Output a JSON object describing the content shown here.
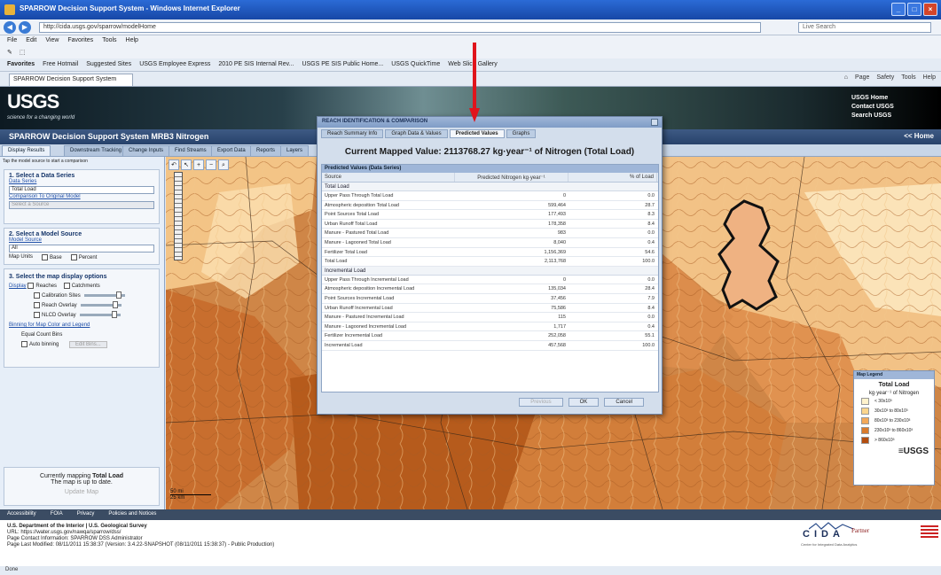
{
  "window": {
    "title": "SPARROW Decision Support System - Windows Internet Explorer"
  },
  "browser": {
    "url": "http://cida.usgs.gov/sparrow/modelHome",
    "search_placeholder": "Live Search",
    "menu": [
      "File",
      "Edit",
      "View",
      "Favorites",
      "Tools",
      "Help"
    ],
    "favorites": [
      "Favorites",
      "Free Hotmail",
      "Suggested Sites",
      "USGS Employee Express",
      "2010 PE SIS Internal Rev...",
      "USGS PE SIS Public Home...",
      "USGS QuickTime",
      "Web Slice Gallery"
    ],
    "tab": "SPARROW Decision Support System",
    "tools": [
      "Page",
      "Safety",
      "Tools",
      "Help"
    ]
  },
  "banner": {
    "logo": "USGS",
    "tagline": "science for a changing world",
    "links": [
      "USGS Home",
      "Contact USGS",
      "Search USGS"
    ]
  },
  "app": {
    "title": "SPARROW Decision Support System MRB3 Nitrogen",
    "home": "<< Home",
    "tabs": [
      "Display Results",
      "Downstream Tracking",
      "Change Inputs",
      "Find Streams",
      "Export Data",
      "Reports",
      "Layers"
    ]
  },
  "sidebar": {
    "help": "Tap the model source to start a comparison",
    "step1": {
      "title": "1. Select a Data Series",
      "label": "Data Series",
      "value": "Total Load",
      "link": "Comparison To Original Model",
      "disabled": "Select a Source"
    },
    "step2": {
      "title": "2. Select a Model Source",
      "label": "Model Source",
      "value": "All",
      "opts": [
        "Map Units",
        "Base",
        "Percent"
      ]
    },
    "step3": {
      "title": "3. Select the map display options",
      "display": "Display",
      "reaches": "Reaches",
      "catchments": "Catchments",
      "layers": [
        "Calibration Sites",
        "Reach Overlay",
        "NLCD Overlay"
      ],
      "bin_title": "Binning for Map Color and Legend",
      "bin_opt": "Equal Count Bins",
      "auto": "Auto binning",
      "edit": "Edit Bins..."
    },
    "status": {
      "line1": "Currently mapping",
      "strong": "Total Load",
      "line2": "The map is up to date.",
      "btn": "Update Map"
    }
  },
  "map": {
    "scale_km": "50 mi",
    "scale_mi": "25 km"
  },
  "dialog": {
    "title": "REACH IDENTIFICATION & COMPARISON",
    "tabs": [
      "Reach Summary Info",
      "Graph Data & Values",
      "Predicted Values",
      "Graphs"
    ],
    "heading": "Current Mapped Value: 2113768.27 kg·year⁻¹ of Nitrogen (Total Load)",
    "panel_title": "Predicted Values (Data Series)",
    "columns": [
      "Source",
      "Predicted Nitrogen kg·year⁻¹",
      "% of Load"
    ],
    "groups": [
      {
        "name": "Total Load",
        "rows": [
          [
            "Upper Pass Through Total Load",
            "0",
            "0.0"
          ],
          [
            "Atmospheric deposition Total Load",
            "599,464",
            "28.7"
          ],
          [
            "Point Sources Total Load",
            "177,493",
            "8.3"
          ],
          [
            "Urban Runoff Total Load",
            "178,358",
            "8.4"
          ],
          [
            "Manure - Pastured Total Load",
            "983",
            "0.0"
          ],
          [
            "Manure - Lagooned Total Load",
            "8,040",
            "0.4"
          ],
          [
            "Fertilizer Total Load",
            "1,156,369",
            "54.6"
          ],
          [
            "Total Load",
            "2,113,768",
            "100.0"
          ]
        ]
      },
      {
        "name": "Incremental Load",
        "rows": [
          [
            "Upper Pass Through Incremental Load",
            "0",
            "0.0"
          ],
          [
            "Atmospheric deposition Incremental Load",
            "135,034",
            "28.4"
          ],
          [
            "Point Sources Incremental Load",
            "37,456",
            "7.9"
          ],
          [
            "Urban Runoff Incremental Load",
            "75,586",
            "8.4"
          ],
          [
            "Manure - Pastured Incremental Load",
            "115",
            "0.0"
          ],
          [
            "Manure - Lagooned Incremental Load",
            "1,717",
            "0.4"
          ],
          [
            "Fertilizer Incremental Load",
            "252,058",
            "55.1"
          ],
          [
            "Incremental Load",
            "457,568",
            "100.0"
          ]
        ]
      }
    ],
    "buttons": [
      "Previous",
      "OK",
      "Cancel"
    ]
  },
  "legend": {
    "header": "Map Legend",
    "title": "Total Load",
    "unit": "kg·year⁻¹ of Nitrogen",
    "bins": [
      {
        "label": "< 30x10³",
        "color": "#fff2cc"
      },
      {
        "label": "30x10³ to 80x10³",
        "color": "#fbd58c"
      },
      {
        "label": "80x10³ to 230x10³",
        "color": "#f3a959"
      },
      {
        "label": "230x10³ to 860x10³",
        "color": "#d97b2c"
      },
      {
        "label": "> 860x10³",
        "color": "#b34d0f"
      }
    ],
    "logo": "≡USGS"
  },
  "footer": {
    "nav": [
      "Accessibility",
      "FOIA",
      "Privacy",
      "Policies and Notices"
    ],
    "lines": [
      "U.S. Department of the Interior  |  U.S. Geological Survey",
      "URL: https://water.usgs.gov/nawqa/sparrow/dss/",
      "Page Contact Information: SPARROW DSS Administrator",
      "Page Last Modified: 08/11/2011 15:38:37 (Version: 3.4.22-SNAPSHOT (08/11/2011 15:38:37) - Public Production)"
    ],
    "cida": "CIDA",
    "cida_sub": "Center for Integrated Data Analytics",
    "partner": "Partner"
  },
  "statusbar": "Done",
  "annotation_color": "#e0141c"
}
